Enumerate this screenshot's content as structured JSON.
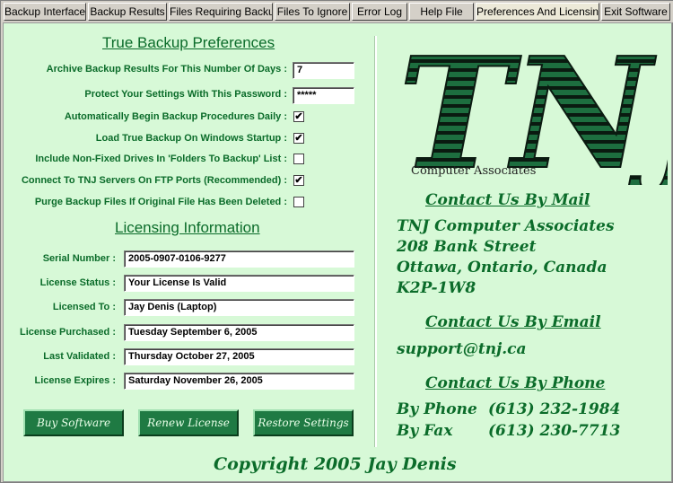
{
  "tabs": [
    "Backup Interface",
    "Backup Results",
    "Files Requiring Backup",
    "Files To Ignore",
    "Error Log",
    "Help File",
    "Preferences And Licensing",
    "Exit Software"
  ],
  "preferences": {
    "heading": "True Backup Preferences",
    "archive_days_label": "Archive Backup Results For This Number Of Days :",
    "archive_days_value": "7",
    "password_label": "Protect Your Settings With This Password :",
    "password_value": "*****",
    "auto_begin_label": "Automatically Begin Backup Procedures Daily :",
    "auto_begin_checked": true,
    "load_startup_label": "Load True Backup On Windows Startup :",
    "load_startup_checked": true,
    "non_fixed_label": "Include Non-Fixed Drives In 'Folders To Backup' List :",
    "non_fixed_checked": false,
    "ftp_label": "Connect To TNJ Servers On FTP Ports (Recommended) :",
    "ftp_checked": true,
    "purge_label": "Purge Backup Files If Original File Has Been Deleted :",
    "purge_checked": false,
    "check_glyph": "✔"
  },
  "licensing": {
    "heading": "Licensing Information",
    "serial_label": "Serial Number :",
    "serial_value": "2005-0907-0106-9277",
    "status_label": "License Status :",
    "status_value": "Your License Is Valid",
    "licensed_to_label": "Licensed To :",
    "licensed_to_value": "Jay Denis (Laptop)",
    "purchased_label": "License Purchased :",
    "purchased_value": "Tuesday September 6, 2005",
    "validated_label": "Last Validated :",
    "validated_value": "Thursday October 27, 2005",
    "expires_label": "License Expires :",
    "expires_value": "Saturday November 26, 2005"
  },
  "buttons": {
    "buy": "Buy Software",
    "renew": "Renew License",
    "restore": "Restore Settings"
  },
  "logo": {
    "letters": "TNJ",
    "subtitle": "Computer Associates"
  },
  "contact": {
    "mail_heading": "Contact Us By Mail",
    "mail_line1": "TNJ Computer Associates",
    "mail_line2": "208 Bank Street",
    "mail_line3": "Ottawa, Ontario, Canada",
    "mail_line4": "K2P-1W8",
    "email_heading": "Contact Us By Email",
    "email": "support@tnj.ca",
    "phone_heading": "Contact Us By Phone",
    "phone_label": "By Phone",
    "phone_value": "(613) 232-1984",
    "fax_label": "By Fax",
    "fax_value": "(613) 230-7713"
  },
  "copyright": "Copyright 2005 Jay Denis",
  "colors": {
    "panel_bg": "#d7f9d7",
    "accent_green": "#0b6c2a",
    "button_green": "#1f7a43"
  }
}
